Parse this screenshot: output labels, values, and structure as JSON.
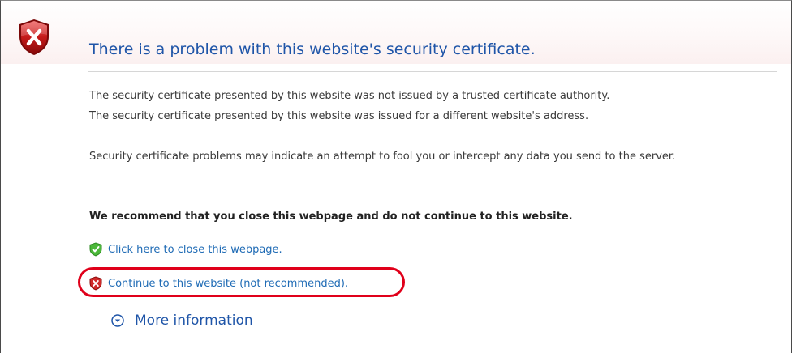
{
  "header": {
    "title": "There is a problem with this website's security certificate.",
    "error_icon": "shield-x-icon"
  },
  "details": {
    "line1": "The security certificate presented by this website was not issued by a trusted certificate authority.",
    "line2": "The security certificate presented by this website was issued for a different website's address.",
    "warning": "Security certificate problems may indicate an attempt to fool you or intercept any data you send to the server."
  },
  "recommendation": "We recommend that you close this webpage and do not continue to this website.",
  "actions": {
    "close_link": "Click here to close this webpage.",
    "close_icon": "shield-check-icon",
    "continue_link": "Continue to this website (not recommended).",
    "continue_icon": "shield-x-icon"
  },
  "more_info": {
    "label": "More information",
    "icon": "chevron-down-circle-icon"
  },
  "colors": {
    "title": "#1f55a8",
    "link": "#1f6bb5",
    "error_red": "#c41a1a",
    "safe_green": "#3a9a2a",
    "highlight": "#e0001a"
  }
}
